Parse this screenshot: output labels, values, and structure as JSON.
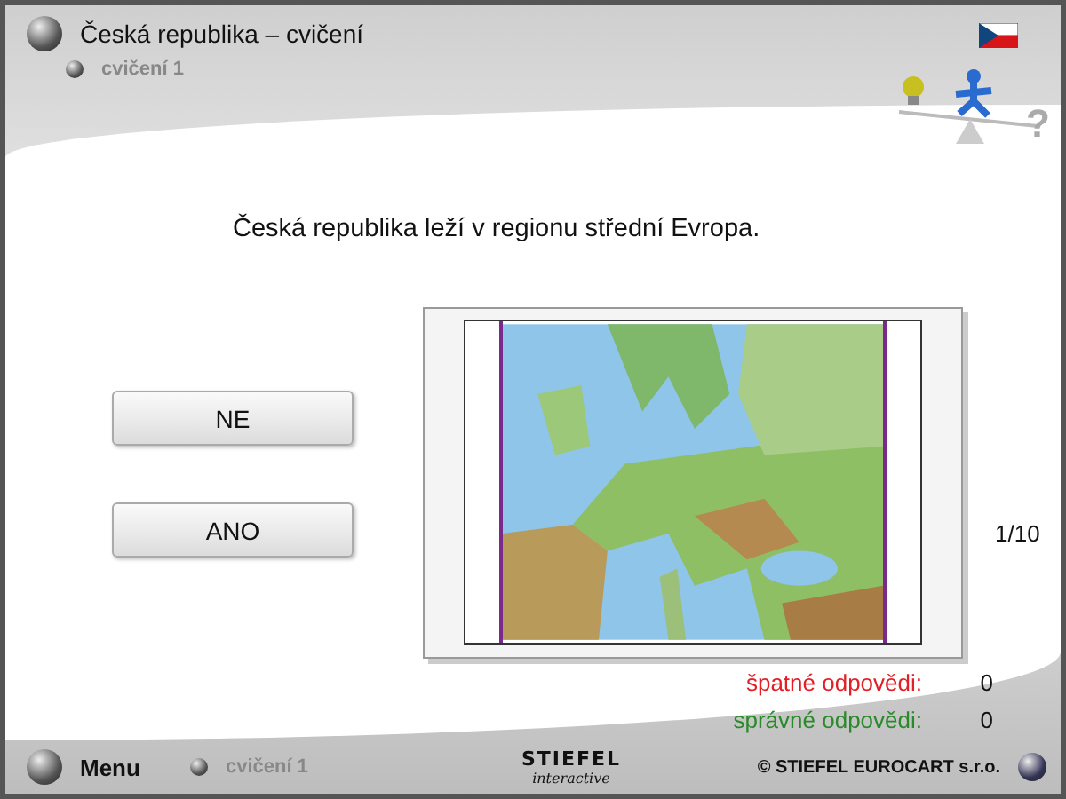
{
  "header": {
    "title": "Česká republika – cvičení",
    "subtitle": "cvičení 1",
    "help_symbol": "?"
  },
  "question": "Česká republika leží v regionu střední Evropa.",
  "answers": [
    {
      "label": "NE"
    },
    {
      "label": "ANO"
    }
  ],
  "counter": "1/10",
  "scores": [
    {
      "label": "špatné odpovědi:",
      "value": "0",
      "color": "#e31e24"
    },
    {
      "label": "správné odpovědi:",
      "value": "0",
      "color": "#2a8a2a"
    }
  ],
  "footer": {
    "menu": "Menu",
    "subtitle": "cvičení 1",
    "logo_top": "STIEFEL",
    "logo_bottom": "interactive",
    "copyright": "© STIEFEL EUROCART s.r.o."
  }
}
